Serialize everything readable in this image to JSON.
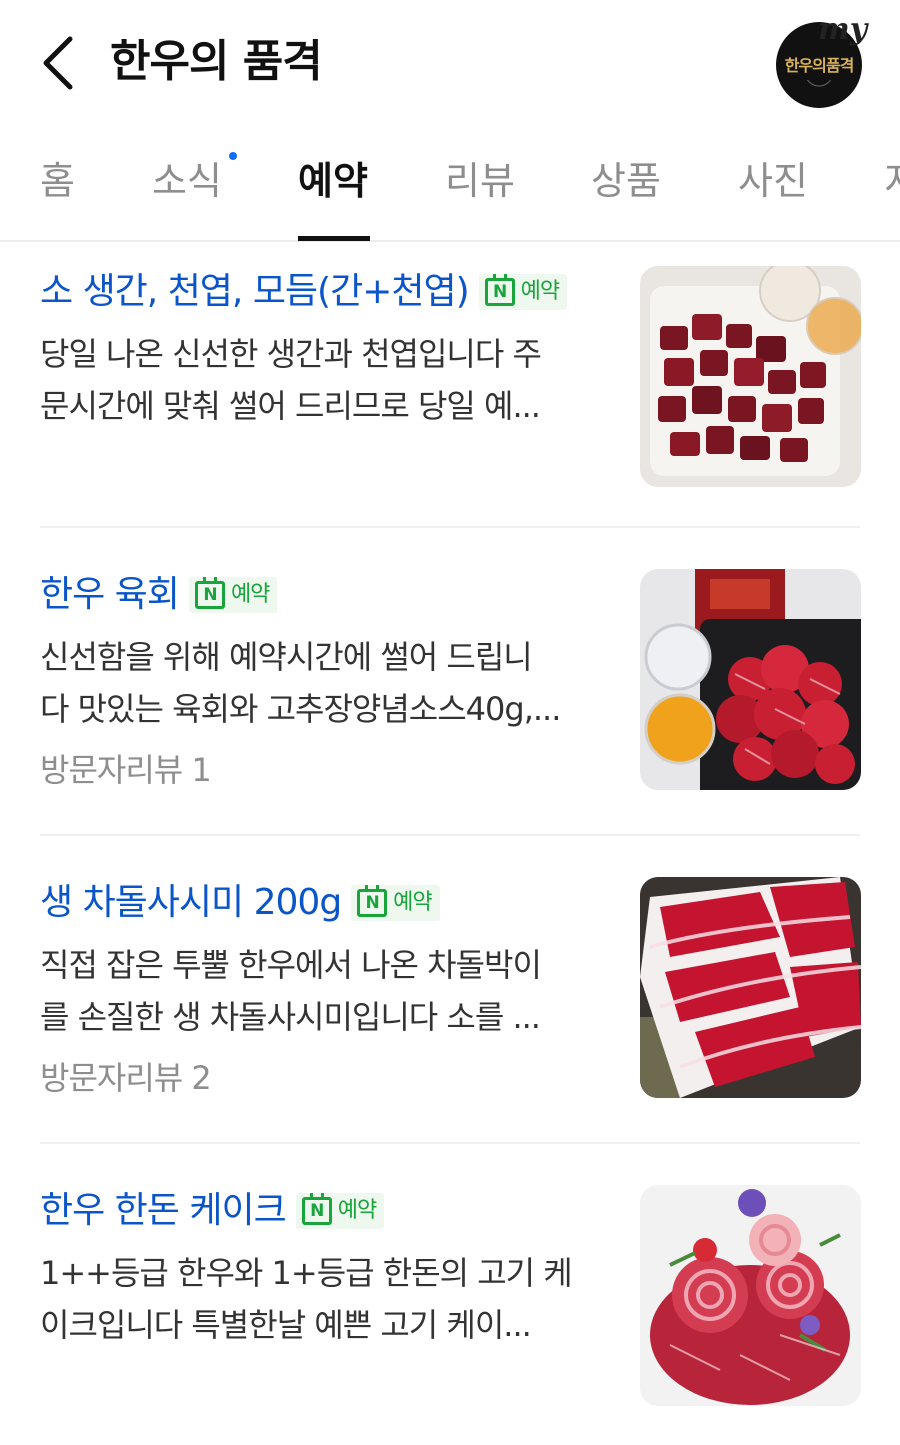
{
  "header": {
    "title": "한우의 품격",
    "back_icon": "chevron-left-icon",
    "logo": {
      "my": "my",
      "name": "한우의품격"
    }
  },
  "tabs": [
    {
      "label": "홈",
      "active": false
    },
    {
      "label": "소식",
      "active": false,
      "new_dot": true
    },
    {
      "label": "예약",
      "active": true
    },
    {
      "label": "리뷰",
      "active": false
    },
    {
      "label": "상품",
      "active": false
    },
    {
      "label": "사진",
      "active": false
    },
    {
      "label": "지",
      "active": false
    }
  ],
  "items": [
    {
      "title": "소 생간, 천엽, 모듬(간+천엽)",
      "badge": "예약",
      "desc_line1": "당일 나온 신선한 생간과 천엽입니다 주",
      "desc_line2": "문시간에 맞춰 썰어 드리므로 당일 예...",
      "review": ""
    },
    {
      "title": "한우 육회",
      "badge": "예약",
      "desc_line1": "신선함을 위해 예약시간에 썰어 드립니",
      "desc_line2": "다 맛있는 육회와 고추장양념소스40g,...",
      "review": "방문자리뷰 1"
    },
    {
      "title": "생 차돌사시미 200g",
      "badge": "예약",
      "desc_line1": "직접 잡은 투뿔 한우에서 나온 차돌박이",
      "desc_line2": "를 손질한 생 차돌사시미입니다 소를 ...",
      "review": "방문자리뷰 2"
    },
    {
      "title": "한우 한돈 케이크",
      "badge": "예약",
      "desc_line1": "1++등급 한우와 1+등급 한돈의 고기 케",
      "desc_line2": "이크입니다 특별한날 예쁜 고기 케이...",
      "review": ""
    }
  ],
  "colors": {
    "title_blue": "#0a55c9",
    "badge_green": "#1aa53c",
    "badge_bg": "#eef8ef",
    "new_dot": "#0f6ef6",
    "meat_red": "#b3162b"
  }
}
